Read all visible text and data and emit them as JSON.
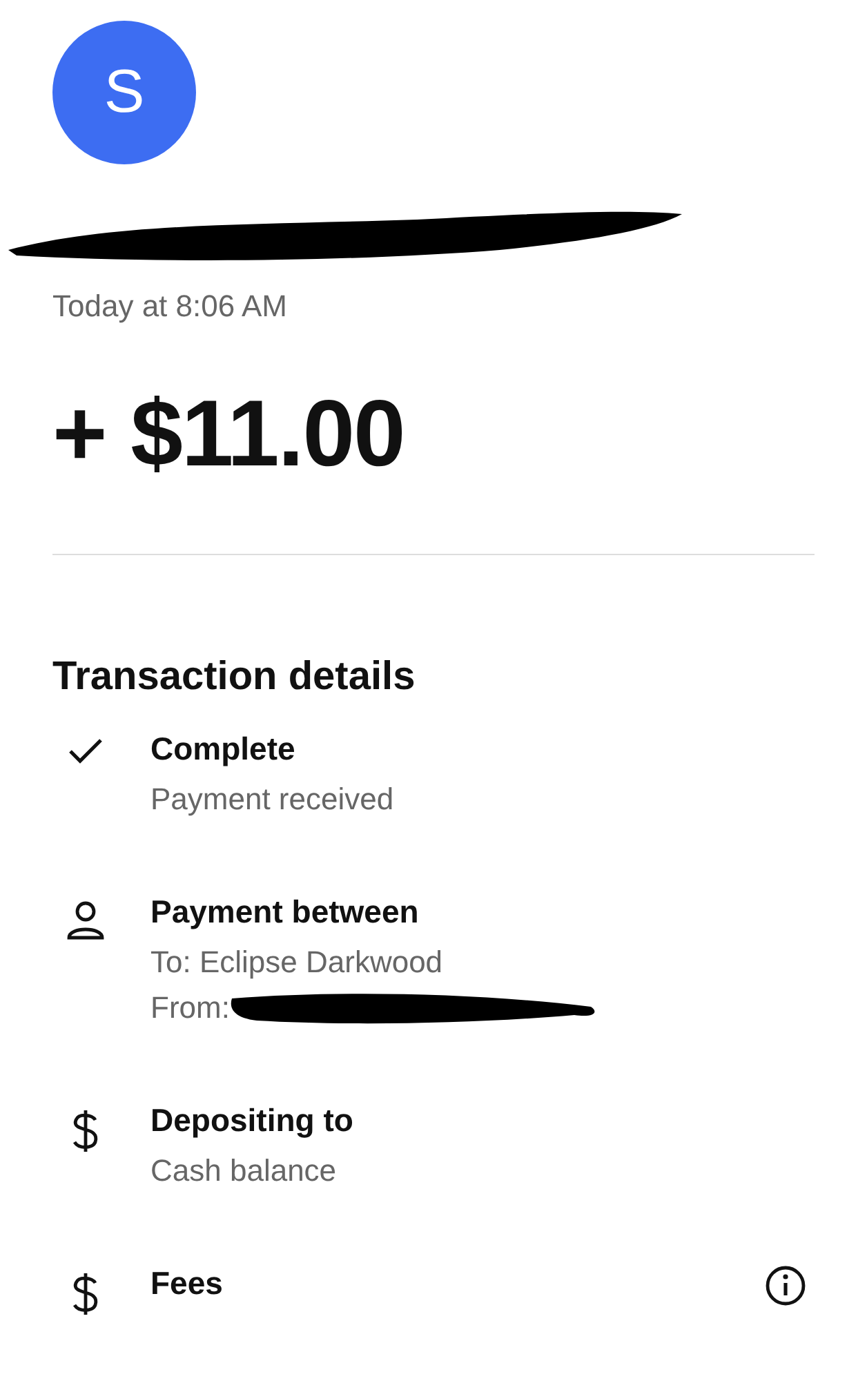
{
  "avatar": {
    "initial": "S",
    "color": "#3d6df2"
  },
  "name": {
    "redacted": true
  },
  "time": "Today at 8:06 AM",
  "amount": "+ $11.00",
  "section_title": "Transaction details",
  "details": [
    {
      "kind": "check",
      "title": "Complete",
      "lines": [
        {
          "text": "Payment received"
        }
      ]
    },
    {
      "kind": "person",
      "title": "Payment between",
      "lines": [
        {
          "text": "To: Eclipse Darkwood"
        },
        {
          "text": "From:",
          "redacted": true
        }
      ]
    },
    {
      "kind": "dollar",
      "title": "Depositing to",
      "lines": [
        {
          "text": "Cash balance"
        }
      ]
    },
    {
      "kind": "dollar",
      "title": "Fees",
      "info": true
    }
  ]
}
